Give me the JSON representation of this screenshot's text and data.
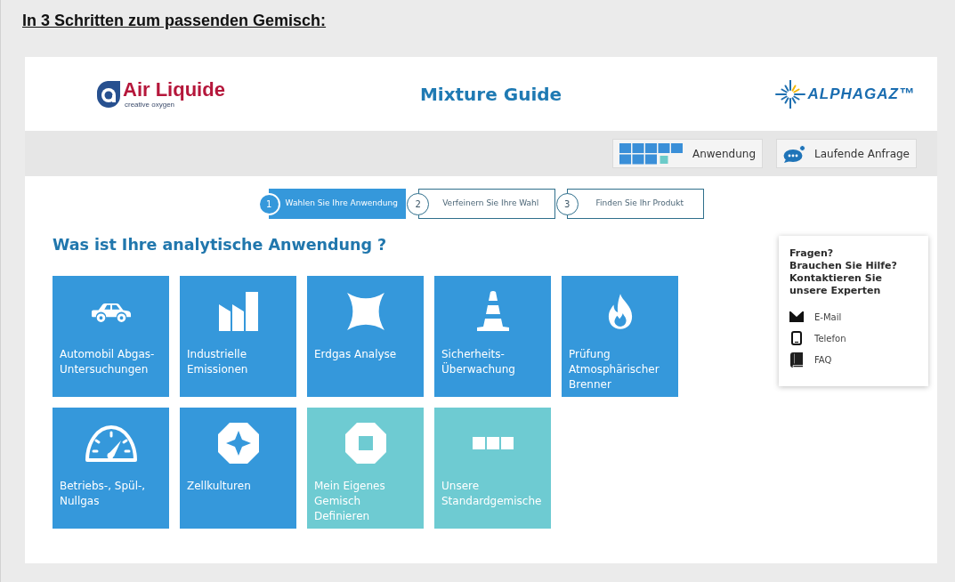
{
  "heading": "In 3 Schritten zum passenden Gemisch:",
  "header": {
    "left_logo": {
      "name": "Air Liquide",
      "tagline": "creative oxygen"
    },
    "title": "Mixture Guide",
    "right_logo": {
      "name": "ALPHAGAZ™"
    }
  },
  "toolbar_buttons": [
    "Anwendung",
    "Laufende Anfrage"
  ],
  "steps": [
    {
      "number": "1",
      "label": "Wahlen Sie Ihre Anwendung",
      "selected": true
    },
    {
      "number": "2",
      "label": "Verfeinern Sie Ihre Wahl",
      "selected": false
    },
    {
      "number": "3",
      "label": "Finden Sie Ihr Produkt",
      "selected": false
    }
  ],
  "question": "Was ist Ihre analytische Anwendung ?",
  "tiles": [
    {
      "label": "Automobil Abgas-Untersuchungen",
      "color": "#3598db"
    },
    {
      "label": "Industrielle Emissionen",
      "color": "#3598db"
    },
    {
      "label": "Erdgas Analyse",
      "color": "#3598db"
    },
    {
      "label": "Sicherheits-Überwachung",
      "color": "#3598db"
    },
    {
      "label": "Prüfung Atmosphärischer Brenner",
      "color": "#3598db"
    },
    {
      "label": "Betriebs-, Spül-, Nullgas",
      "color": "#3598db"
    },
    {
      "label": "Zellkulturen",
      "color": "#3598db"
    },
    {
      "label": "Mein Eigenes Gemisch Definieren",
      "color": "#6ecbd2"
    },
    {
      "label": "Unsere Standardgemische",
      "color": "#6ecbd2"
    }
  ],
  "help": {
    "lines": [
      "Fragen?",
      "Brauchen Sie Hilfe?",
      "Kontaktieren Sie unsere Experten"
    ],
    "links": [
      "E-Mail",
      "Telefon",
      "FAQ"
    ]
  }
}
